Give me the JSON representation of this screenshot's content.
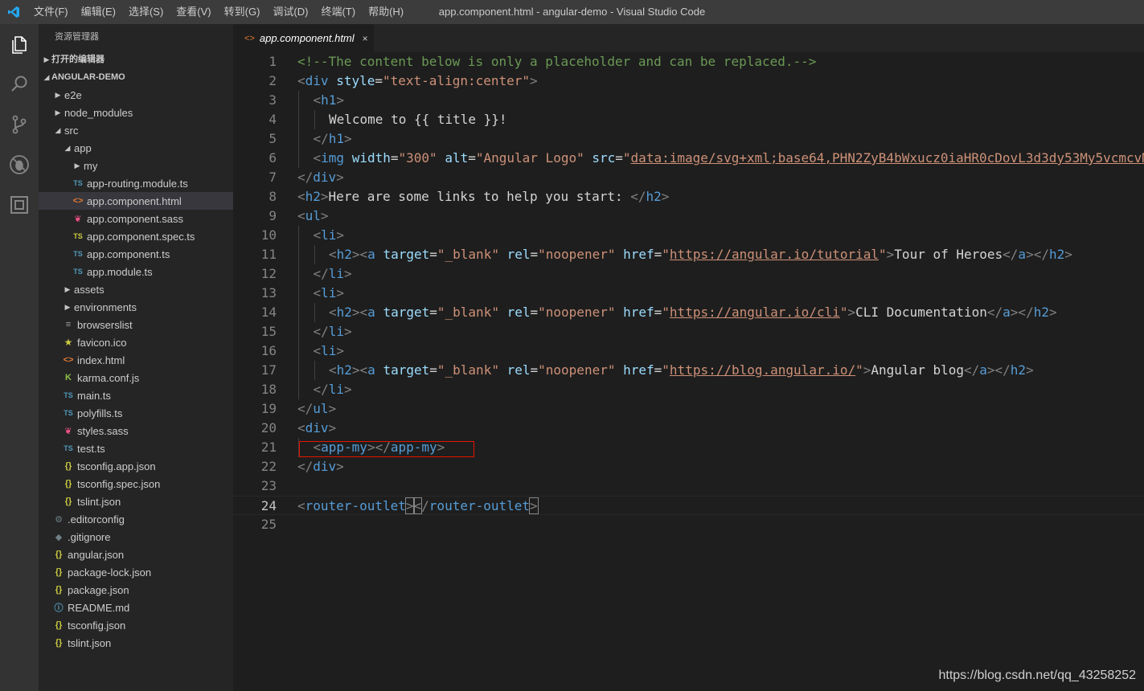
{
  "window": {
    "title": "app.component.html - angular-demo - Visual Studio Code"
  },
  "menu": [
    "文件(F)",
    "编辑(E)",
    "选择(S)",
    "查看(V)",
    "转到(G)",
    "调试(D)",
    "终端(T)",
    "帮助(H)"
  ],
  "activity_bar": [
    {
      "name": "explorer-icon"
    },
    {
      "name": "search-icon"
    },
    {
      "name": "source-control-icon"
    },
    {
      "name": "debug-icon"
    },
    {
      "name": "extensions-icon"
    }
  ],
  "sidebar": {
    "title": "资源管理器",
    "open_editors_label": "打开的编辑器",
    "project_label": "ANGULAR-DEMO",
    "tree": [
      {
        "label": "e2e",
        "depth": 0,
        "kind": "folder",
        "expanded": false
      },
      {
        "label": "node_modules",
        "depth": 0,
        "kind": "folder",
        "expanded": false
      },
      {
        "label": "src",
        "depth": 0,
        "kind": "folder",
        "expanded": true
      },
      {
        "label": "app",
        "depth": 1,
        "kind": "folder",
        "expanded": true
      },
      {
        "label": "my",
        "depth": 2,
        "kind": "folder",
        "expanded": false
      },
      {
        "label": "app-routing.module.ts",
        "depth": 2,
        "kind": "file",
        "icon": "TS",
        "icon_type": "ts"
      },
      {
        "label": "app.component.html",
        "depth": 2,
        "kind": "file",
        "icon": "<>",
        "icon_type": "html",
        "selected": true
      },
      {
        "label": "app.component.sass",
        "depth": 2,
        "kind": "file",
        "icon": "❦",
        "icon_type": "sass"
      },
      {
        "label": "app.component.spec.ts",
        "depth": 2,
        "kind": "file",
        "icon": "TS",
        "icon_type": "tsyellow"
      },
      {
        "label": "app.component.ts",
        "depth": 2,
        "kind": "file",
        "icon": "TS",
        "icon_type": "ts"
      },
      {
        "label": "app.module.ts",
        "depth": 2,
        "kind": "file",
        "icon": "TS",
        "icon_type": "ts"
      },
      {
        "label": "assets",
        "depth": 1,
        "kind": "folder",
        "expanded": false
      },
      {
        "label": "environments",
        "depth": 1,
        "kind": "folder",
        "expanded": false
      },
      {
        "label": "browserslist",
        "depth": 1,
        "kind": "file",
        "icon": "≡",
        "icon_type": "lines"
      },
      {
        "label": "favicon.ico",
        "depth": 1,
        "kind": "file",
        "icon": "★",
        "icon_type": "fav"
      },
      {
        "label": "index.html",
        "depth": 1,
        "kind": "file",
        "icon": "<>",
        "icon_type": "html"
      },
      {
        "label": "karma.conf.js",
        "depth": 1,
        "kind": "file",
        "icon": "K",
        "icon_type": "karma"
      },
      {
        "label": "main.ts",
        "depth": 1,
        "kind": "file",
        "icon": "TS",
        "icon_type": "ts"
      },
      {
        "label": "polyfills.ts",
        "depth": 1,
        "kind": "file",
        "icon": "TS",
        "icon_type": "ts"
      },
      {
        "label": "styles.sass",
        "depth": 1,
        "kind": "file",
        "icon": "❦",
        "icon_type": "sass"
      },
      {
        "label": "test.ts",
        "depth": 1,
        "kind": "file",
        "icon": "TS",
        "icon_type": "ts"
      },
      {
        "label": "tsconfig.app.json",
        "depth": 1,
        "kind": "file",
        "icon": "{}",
        "icon_type": "json"
      },
      {
        "label": "tsconfig.spec.json",
        "depth": 1,
        "kind": "file",
        "icon": "{}",
        "icon_type": "json"
      },
      {
        "label": "tslint.json",
        "depth": 1,
        "kind": "file",
        "icon": "{}",
        "icon_type": "json"
      },
      {
        "label": ".editorconfig",
        "depth": 0,
        "kind": "file",
        "icon": "⚙",
        "icon_type": "grey"
      },
      {
        "label": ".gitignore",
        "depth": 0,
        "kind": "file",
        "icon": "◆",
        "icon_type": "grey"
      },
      {
        "label": "angular.json",
        "depth": 0,
        "kind": "file",
        "icon": "{}",
        "icon_type": "json"
      },
      {
        "label": "package-lock.json",
        "depth": 0,
        "kind": "file",
        "icon": "{}",
        "icon_type": "json"
      },
      {
        "label": "package.json",
        "depth": 0,
        "kind": "file",
        "icon": "{}",
        "icon_type": "json"
      },
      {
        "label": "README.md",
        "depth": 0,
        "kind": "file",
        "icon": "ⓘ",
        "icon_type": "info"
      },
      {
        "label": "tsconfig.json",
        "depth": 0,
        "kind": "file",
        "icon": "{}",
        "icon_type": "json"
      },
      {
        "label": "tslint.json",
        "depth": 0,
        "kind": "file",
        "icon": "{}",
        "icon_type": "json"
      }
    ]
  },
  "tab": {
    "icon": "<>",
    "label": "app.component.html",
    "close": "×"
  },
  "editor": {
    "active_line": 24,
    "lines": [
      {
        "n": "1",
        "indent": 0,
        "tokens": [
          [
            "c",
            "<!--The content below is only a placeholder and can be replaced.-->"
          ]
        ]
      },
      {
        "n": "2",
        "indent": 0,
        "tokens": [
          [
            "p",
            "<"
          ],
          [
            "t",
            "div"
          ],
          [
            "x",
            " "
          ],
          [
            "a",
            "style"
          ],
          [
            "x",
            "="
          ],
          [
            "s",
            "\"text-align:center\""
          ],
          [
            "p",
            ">"
          ]
        ]
      },
      {
        "n": "3",
        "indent": 1,
        "tokens": [
          [
            "p",
            "<"
          ],
          [
            "t",
            "h1"
          ],
          [
            "p",
            ">"
          ]
        ]
      },
      {
        "n": "4",
        "indent": 2,
        "tokens": [
          [
            "x",
            "Welcome to {{ title }}!"
          ]
        ]
      },
      {
        "n": "5",
        "indent": 1,
        "tokens": [
          [
            "p",
            "</"
          ],
          [
            "t",
            "h1"
          ],
          [
            "p",
            ">"
          ]
        ]
      },
      {
        "n": "6",
        "indent": 1,
        "tokens": [
          [
            "p",
            "<"
          ],
          [
            "t",
            "img"
          ],
          [
            "x",
            " "
          ],
          [
            "a",
            "width"
          ],
          [
            "x",
            "="
          ],
          [
            "s",
            "\"300\""
          ],
          [
            "x",
            " "
          ],
          [
            "a",
            "alt"
          ],
          [
            "x",
            "="
          ],
          [
            "s",
            "\"Angular Logo\""
          ],
          [
            "x",
            " "
          ],
          [
            "a",
            "src"
          ],
          [
            "x",
            "="
          ],
          [
            "s",
            "\""
          ],
          [
            "u",
            "data:image/svg+xml;base64,PHN2ZyB4bWxucz0iaHR0cDovL3d3dy53My5vcmcvMjAwMC9zdmciIHZpZXdCb3g9IjAgMCAyNTAgMjUwIj4="
          ]
        ]
      },
      {
        "n": "7",
        "indent": 0,
        "tokens": [
          [
            "p",
            "</"
          ],
          [
            "t",
            "div"
          ],
          [
            "p",
            ">"
          ]
        ]
      },
      {
        "n": "8",
        "indent": 0,
        "tokens": [
          [
            "p",
            "<"
          ],
          [
            "t",
            "h2"
          ],
          [
            "p",
            ">"
          ],
          [
            "x",
            "Here are some links to help you start: "
          ],
          [
            "p",
            "</"
          ],
          [
            "t",
            "h2"
          ],
          [
            "p",
            ">"
          ]
        ]
      },
      {
        "n": "9",
        "indent": 0,
        "tokens": [
          [
            "p",
            "<"
          ],
          [
            "t",
            "ul"
          ],
          [
            "p",
            ">"
          ]
        ]
      },
      {
        "n": "10",
        "indent": 1,
        "tokens": [
          [
            "p",
            "<"
          ],
          [
            "t",
            "li"
          ],
          [
            "p",
            ">"
          ]
        ]
      },
      {
        "n": "11",
        "indent": 2,
        "tokens": [
          [
            "p",
            "<"
          ],
          [
            "t",
            "h2"
          ],
          [
            "p",
            "><"
          ],
          [
            "t",
            "a"
          ],
          [
            "x",
            " "
          ],
          [
            "a",
            "target"
          ],
          [
            "x",
            "="
          ],
          [
            "s",
            "\"_blank\""
          ],
          [
            "x",
            " "
          ],
          [
            "a",
            "rel"
          ],
          [
            "x",
            "="
          ],
          [
            "s",
            "\"noopener\""
          ],
          [
            "x",
            " "
          ],
          [
            "a",
            "href"
          ],
          [
            "x",
            "="
          ],
          [
            "s",
            "\""
          ],
          [
            "u",
            "https://angular.io/tutorial"
          ],
          [
            "s",
            "\""
          ],
          [
            "p",
            ">"
          ],
          [
            "x",
            "Tour of Heroes"
          ],
          [
            "p",
            "</"
          ],
          [
            "t",
            "a"
          ],
          [
            "p",
            "></"
          ],
          [
            "t",
            "h2"
          ],
          [
            "p",
            ">"
          ]
        ]
      },
      {
        "n": "12",
        "indent": 1,
        "tokens": [
          [
            "p",
            "</"
          ],
          [
            "t",
            "li"
          ],
          [
            "p",
            ">"
          ]
        ]
      },
      {
        "n": "13",
        "indent": 1,
        "tokens": [
          [
            "p",
            "<"
          ],
          [
            "t",
            "li"
          ],
          [
            "p",
            ">"
          ]
        ]
      },
      {
        "n": "14",
        "indent": 2,
        "tokens": [
          [
            "p",
            "<"
          ],
          [
            "t",
            "h2"
          ],
          [
            "p",
            "><"
          ],
          [
            "t",
            "a"
          ],
          [
            "x",
            " "
          ],
          [
            "a",
            "target"
          ],
          [
            "x",
            "="
          ],
          [
            "s",
            "\"_blank\""
          ],
          [
            "x",
            " "
          ],
          [
            "a",
            "rel"
          ],
          [
            "x",
            "="
          ],
          [
            "s",
            "\"noopener\""
          ],
          [
            "x",
            " "
          ],
          [
            "a",
            "href"
          ],
          [
            "x",
            "="
          ],
          [
            "s",
            "\""
          ],
          [
            "u",
            "https://angular.io/cli"
          ],
          [
            "s",
            "\""
          ],
          [
            "p",
            ">"
          ],
          [
            "x",
            "CLI Documentation"
          ],
          [
            "p",
            "</"
          ],
          [
            "t",
            "a"
          ],
          [
            "p",
            "></"
          ],
          [
            "t",
            "h2"
          ],
          [
            "p",
            ">"
          ]
        ]
      },
      {
        "n": "15",
        "indent": 1,
        "tokens": [
          [
            "p",
            "</"
          ],
          [
            "t",
            "li"
          ],
          [
            "p",
            ">"
          ]
        ]
      },
      {
        "n": "16",
        "indent": 1,
        "tokens": [
          [
            "p",
            "<"
          ],
          [
            "t",
            "li"
          ],
          [
            "p",
            ">"
          ]
        ]
      },
      {
        "n": "17",
        "indent": 2,
        "tokens": [
          [
            "p",
            "<"
          ],
          [
            "t",
            "h2"
          ],
          [
            "p",
            "><"
          ],
          [
            "t",
            "a"
          ],
          [
            "x",
            " "
          ],
          [
            "a",
            "target"
          ],
          [
            "x",
            "="
          ],
          [
            "s",
            "\"_blank\""
          ],
          [
            "x",
            " "
          ],
          [
            "a",
            "rel"
          ],
          [
            "x",
            "="
          ],
          [
            "s",
            "\"noopener\""
          ],
          [
            "x",
            " "
          ],
          [
            "a",
            "href"
          ],
          [
            "x",
            "="
          ],
          [
            "s",
            "\""
          ],
          [
            "u",
            "https://blog.angular.io/"
          ],
          [
            "s",
            "\""
          ],
          [
            "p",
            ">"
          ],
          [
            "x",
            "Angular blog"
          ],
          [
            "p",
            "</"
          ],
          [
            "t",
            "a"
          ],
          [
            "p",
            "></"
          ],
          [
            "t",
            "h2"
          ],
          [
            "p",
            ">"
          ]
        ]
      },
      {
        "n": "18",
        "indent": 1,
        "tokens": [
          [
            "p",
            "</"
          ],
          [
            "t",
            "li"
          ],
          [
            "p",
            ">"
          ]
        ]
      },
      {
        "n": "19",
        "indent": 0,
        "tokens": [
          [
            "p",
            "</"
          ],
          [
            "t",
            "ul"
          ],
          [
            "p",
            ">"
          ]
        ]
      },
      {
        "n": "20",
        "indent": 0,
        "tokens": [
          [
            "p",
            "<"
          ],
          [
            "t",
            "div"
          ],
          [
            "p",
            ">"
          ]
        ]
      },
      {
        "n": "21",
        "indent": 1,
        "tokens": [
          [
            "p",
            "<"
          ],
          [
            "t",
            "app-my"
          ],
          [
            "p",
            "></"
          ],
          [
            "t",
            "app-my"
          ],
          [
            "p",
            ">"
          ]
        ]
      },
      {
        "n": "22",
        "indent": 0,
        "tokens": [
          [
            "p",
            "</"
          ],
          [
            "t",
            "div"
          ],
          [
            "p",
            ">"
          ]
        ]
      },
      {
        "n": "23",
        "indent": 0,
        "tokens": []
      },
      {
        "n": "24",
        "indent": 0,
        "tokens": [
          [
            "p",
            "<"
          ],
          [
            "t",
            "router-outlet"
          ],
          [
            "pb",
            ">"
          ],
          [
            "pb",
            "<"
          ],
          [
            "p",
            "/"
          ],
          [
            "t",
            "router-outlet"
          ],
          [
            "pb",
            ">"
          ]
        ]
      },
      {
        "n": "25",
        "indent": 0,
        "tokens": []
      }
    ]
  },
  "watermark": "https://blog.csdn.net/qq_43258252",
  "colors": {
    "accent": "#007acc",
    "highlight_box": "#e51400",
    "comment": "#6a9955",
    "tag": "#569cd6",
    "attribute": "#9cdcfe",
    "string": "#ce9178"
  }
}
